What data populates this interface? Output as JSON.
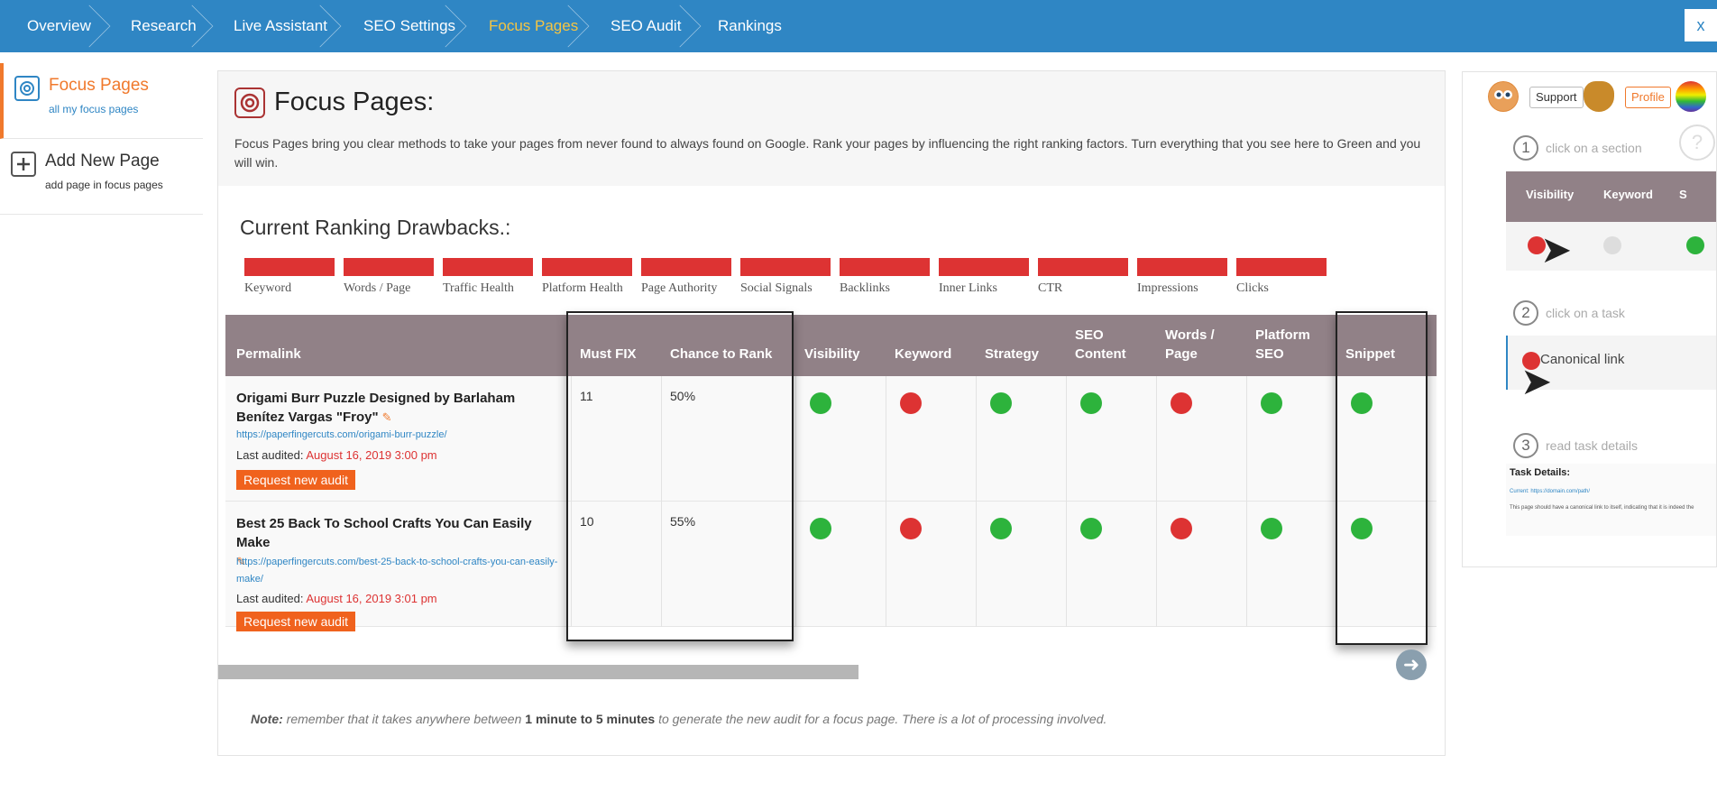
{
  "nav": {
    "items": [
      {
        "label": "Overview",
        "active": false
      },
      {
        "label": "Research",
        "active": false
      },
      {
        "label": "Live Assistant",
        "active": false
      },
      {
        "label": "SEO Settings",
        "active": false
      },
      {
        "label": "Focus Pages",
        "active": true
      },
      {
        "label": "SEO Audit",
        "active": false
      },
      {
        "label": "Rankings",
        "active": false
      }
    ],
    "close_label": "x"
  },
  "sidebar": {
    "items": [
      {
        "title": "Focus Pages",
        "subtitle": "all my focus pages",
        "icon": "focus-pages-icon",
        "active": true
      },
      {
        "title": "Add New Page",
        "subtitle": "add page in focus pages",
        "icon": "plus-icon",
        "active": false
      }
    ]
  },
  "intro": {
    "title": "Focus Pages:",
    "description": "Focus Pages bring you clear methods to take your pages from never found to always found on Google. Rank your pages by influencing the right ranking factors. Turn everything that you see here to Green and you will win."
  },
  "drawbacks": {
    "title": "Current Ranking Drawbacks.:",
    "bar_color": "#dd3333",
    "items": [
      "Keyword",
      "Words / Page",
      "Traffic Health",
      "Platform Health",
      "Page Authority",
      "Social Signals",
      "Backlinks",
      "Inner Links",
      "CTR",
      "Impressions",
      "Clicks"
    ]
  },
  "table": {
    "headers": {
      "permalink": "Permalink",
      "must_fix": "Must FIX",
      "chance": "Chance to Rank",
      "visibility": "Visibility",
      "keyword": "Keyword",
      "strategy": "Strategy",
      "seo_content": "SEO Content",
      "words_page": "Words / Page",
      "platform_seo": "Platform SEO",
      "snippet": "Snippet"
    },
    "rows": [
      {
        "title": "Origami Burr Puzzle Designed by Barlaham Benítez Vargas \"Froy\"",
        "url": "https://paperfingercuts.com/origami-burr-puzzle/",
        "audited_label": "Last audited:",
        "audited_date": "August 16, 2019 3:00 pm",
        "button": "Request new audit",
        "must_fix": "11",
        "chance": "50%",
        "statuses": [
          "green",
          "red",
          "green",
          "green",
          "red",
          "green",
          "green"
        ]
      },
      {
        "title": "Best 25 Back To School Crafts You Can Easily Make",
        "url": "https://paperfingercuts.com/best-25-back-to-school-crafts-you-can-easily-make/",
        "audited_label": "Last audited:",
        "audited_date": "August 16, 2019 3:01 pm",
        "button": "Request new audit",
        "must_fix": "10",
        "chance": "55%",
        "statuses": [
          "green",
          "red",
          "green",
          "green",
          "red",
          "green",
          "green"
        ]
      }
    ]
  },
  "note": {
    "label": "Note:",
    "text_before": "remember that it takes anywhere between",
    "strong": "1 minute to 5 minutes",
    "text_after": "to generate the new audit for a focus page. There is a lot of processing involved."
  },
  "help": {
    "support_label": "Support",
    "profile_label": "Profile",
    "steps": [
      {
        "num": "1",
        "label": "click on a section"
      },
      {
        "num": "2",
        "label": "click on a task"
      },
      {
        "num": "3",
        "label": "read task details"
      }
    ],
    "mini_headers": [
      "Visibility",
      "Keyword",
      "S"
    ],
    "task_label": "Canonical link",
    "details_title": "Task Details:",
    "details_line1": "Current: https://domain.com/path/",
    "details_line2": "This page should have a canonical link to itself, indicating that it is indeed the",
    "question_mark": "?"
  },
  "colors": {
    "nav_bg": "#2f86c4",
    "accent": "#f0792c",
    "status_green": "#2db33c",
    "status_red": "#dd3333",
    "table_header_bg": "#918187"
  }
}
